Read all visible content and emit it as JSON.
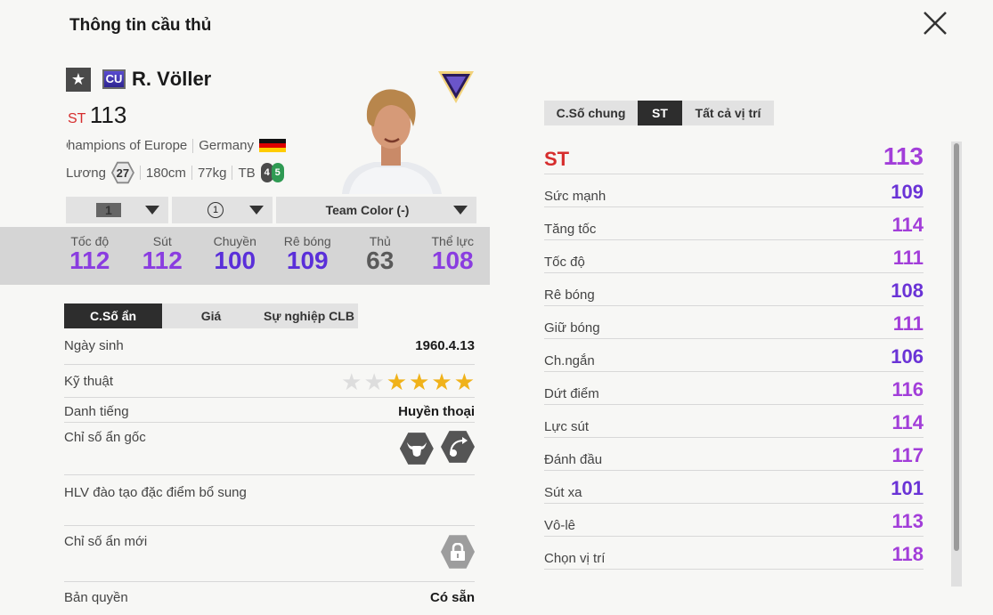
{
  "header": {
    "title": "Thông tin cầu thủ"
  },
  "player": {
    "name": "R. Völler",
    "season_code": "CU",
    "position": "ST",
    "ovr": "113",
    "club": "hampions of Europe",
    "club_initial": "C",
    "nation": "Germany",
    "salary_label": "Lương",
    "salary": "27",
    "height": "180cm",
    "weight": "77kg",
    "body_type": "TB",
    "weak_foot_left": "4",
    "weak_foot_right": "5"
  },
  "selectors": {
    "level": "1",
    "upgrade": "1",
    "team_color": "Team Color (-)"
  },
  "stats": [
    {
      "label": "Tốc độ",
      "value": "112",
      "color": "#8a3de0"
    },
    {
      "label": "Sút",
      "value": "112",
      "color": "#8a3de0"
    },
    {
      "label": "Chuyền",
      "value": "100",
      "color": "#5a2fd9"
    },
    {
      "label": "Rê bóng",
      "value": "109",
      "color": "#5a2fd9"
    },
    {
      "label": "Thủ",
      "value": "63",
      "color": "#5a5a5a"
    },
    {
      "label": "Thể lực",
      "value": "108",
      "color": "#8a3de0"
    }
  ],
  "left_tabs": [
    "C.Số ẩn",
    "Giá",
    "Sự nghiệp CLB"
  ],
  "details": {
    "birth_label": "Ngày sinh",
    "birth": "1960.4.13",
    "skill_label": "Kỹ thuật",
    "skill_stars": 5,
    "rep_label": "Danh tiếng",
    "rep": "Huyền thoại",
    "traits_label": "Chỉ số ẩn gốc",
    "coach_label": "HLV đào tạo đặc điểm bổ sung",
    "new_traits_label": "Chỉ số ẩn mới",
    "license_label": "Bản quyền",
    "license": "Có sẵn"
  },
  "right_tabs": [
    "C.Số chung",
    "ST",
    "Tất cả vị trí"
  ],
  "attributes": [
    {
      "label": "ST",
      "value": "113",
      "color": "#a23ed9"
    },
    {
      "label": "Sức mạnh",
      "value": "109",
      "color": "#6a33d6"
    },
    {
      "label": "Tăng tốc",
      "value": "114",
      "color": "#a23ed9"
    },
    {
      "label": "Tốc độ",
      "value": "111",
      "color": "#a23ed9"
    },
    {
      "label": "Rê bóng",
      "value": "108",
      "color": "#6a33d6"
    },
    {
      "label": "Giữ bóng",
      "value": "111",
      "color": "#a23ed9"
    },
    {
      "label": "Ch.ngắn",
      "value": "106",
      "color": "#6a33d6"
    },
    {
      "label": "Dứt điểm",
      "value": "116",
      "color": "#a23ed9"
    },
    {
      "label": "Lực sút",
      "value": "114",
      "color": "#a23ed9"
    },
    {
      "label": "Đánh đầu",
      "value": "117",
      "color": "#a23ed9"
    },
    {
      "label": "Sút xa",
      "value": "101",
      "color": "#6a33d6"
    },
    {
      "label": "Vô-lê",
      "value": "113",
      "color": "#a23ed9"
    },
    {
      "label": "Chọn vị trí",
      "value": "118",
      "color": "#a23ed9"
    }
  ]
}
